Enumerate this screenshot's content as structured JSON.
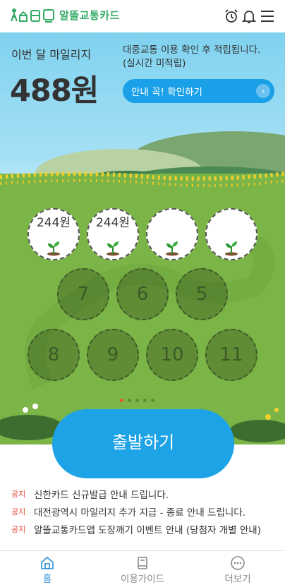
{
  "header": {
    "logo_text": "알뜰교통카드",
    "icons": [
      "alarm-clock-icon",
      "bell-icon",
      "hamburger-menu-icon"
    ]
  },
  "mileage": {
    "label": "이번 달 마일리지",
    "value": "488원",
    "notice_line1": "대중교통 이용 확인 후 적립됩니다.",
    "notice_line2": "(실시간 미적립)",
    "info_button_label": "안내 꼭! 확인하기"
  },
  "stamps": [
    {
      "status": "done",
      "amount": "244원"
    },
    {
      "status": "done",
      "amount": "244원"
    },
    {
      "status": "done",
      "amount": ""
    },
    {
      "status": "done",
      "amount": ""
    },
    {
      "status": "todo",
      "number": "7"
    },
    {
      "status": "todo",
      "number": "6"
    },
    {
      "status": "todo",
      "number": "5"
    },
    {
      "status": "todo",
      "number": "8"
    },
    {
      "status": "todo",
      "number": "9"
    },
    {
      "status": "todo",
      "number": "10"
    },
    {
      "status": "todo",
      "number": "11"
    }
  ],
  "pager": {
    "count": 5,
    "active": 1
  },
  "start_button_label": "출발하기",
  "notices": [
    {
      "tag": "공지",
      "text": "신한카드 신규발급 안내 드립니다."
    },
    {
      "tag": "공지",
      "text": "대전광역시 마일리지 추가 지급 - 종료 안내 드립니다."
    },
    {
      "tag": "공지",
      "text": "알뜰교통카드앱 도장깨기 이벤트 안내 (당첨자 개별 안내)"
    }
  ],
  "bottom_nav": [
    {
      "label": "홈",
      "icon": "home-icon",
      "active": true
    },
    {
      "label": "이용가이드",
      "icon": "guide-book-icon",
      "active": false
    },
    {
      "label": "더보기",
      "icon": "more-dots-icon",
      "active": false
    }
  ],
  "colors": {
    "accent_blue": "#1ea3e6",
    "brand_green": "#33aa66",
    "field_green": "#7cb547",
    "notice_red": "#e24b3b"
  }
}
